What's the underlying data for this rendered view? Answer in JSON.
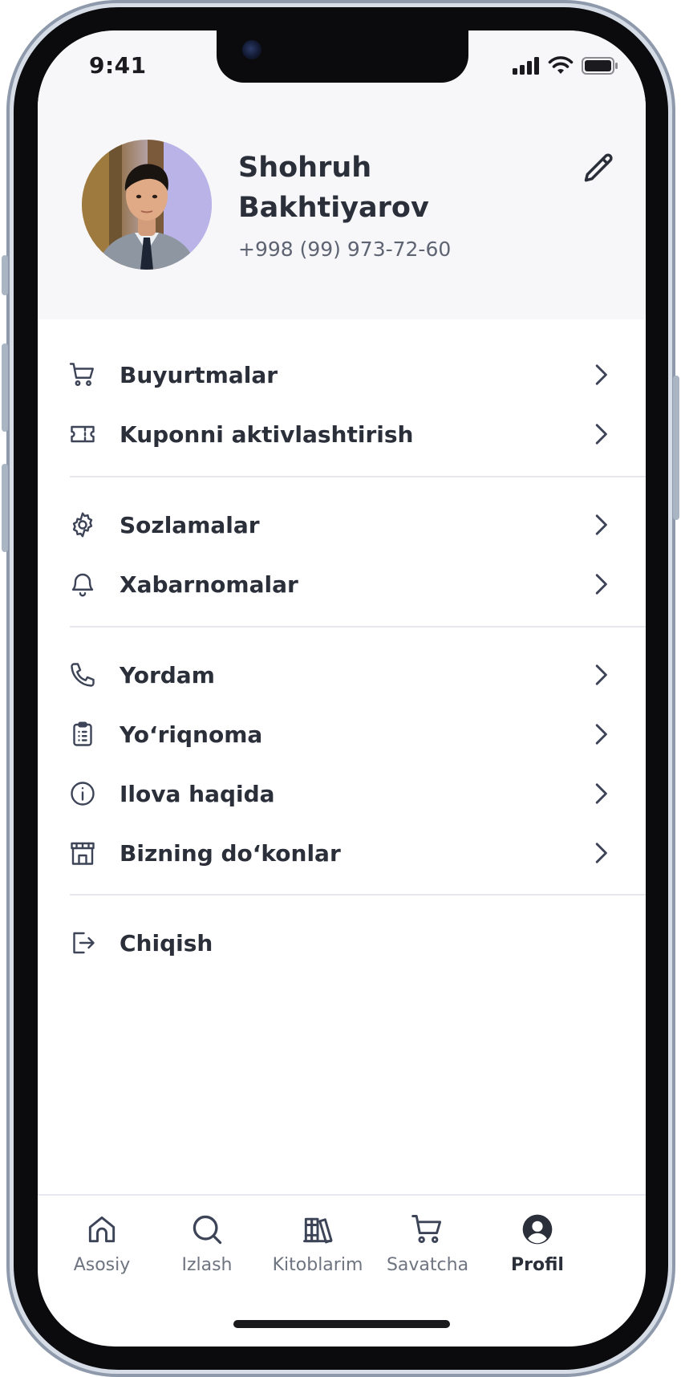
{
  "status_bar": {
    "time": "9:41"
  },
  "profile": {
    "name": "Shohruh Bakhtiyarov",
    "phone": "+998 (99) 973-72-60",
    "edit_icon": "pencil-icon"
  },
  "menu": {
    "groups": [
      [
        {
          "label": "Buyurtmalar",
          "icon": "cart-icon"
        },
        {
          "label": "Kuponni aktivlashtirish",
          "icon": "ticket-icon"
        }
      ],
      [
        {
          "label": "Sozlamalar",
          "icon": "gear-icon"
        },
        {
          "label": "Xabarnomalar",
          "icon": "bell-icon"
        }
      ],
      [
        {
          "label": "Yordam",
          "icon": "phone-icon"
        },
        {
          "label": "Yo‘riqnoma",
          "icon": "clipboard-icon"
        },
        {
          "label": "Ilova haqida",
          "icon": "info-icon"
        },
        {
          "label": "Bizning do‘konlar",
          "icon": "store-icon"
        }
      ]
    ],
    "logout": {
      "label": "Chiqish",
      "icon": "logout-icon"
    }
  },
  "tabbar": {
    "tabs": [
      {
        "label": "Asosiy",
        "icon": "home-icon"
      },
      {
        "label": "Izlash",
        "icon": "search-icon"
      },
      {
        "label": "Kitoblarim",
        "icon": "books-icon"
      },
      {
        "label": "Savatcha",
        "icon": "cart-icon"
      },
      {
        "label": "Profil",
        "icon": "profile-icon"
      }
    ],
    "active": "Profil"
  },
  "colors": {
    "text_primary": "#2b2f3a",
    "text_secondary": "#5e6472",
    "icon": "#3d4457",
    "header_bg": "#f7f7fa"
  }
}
